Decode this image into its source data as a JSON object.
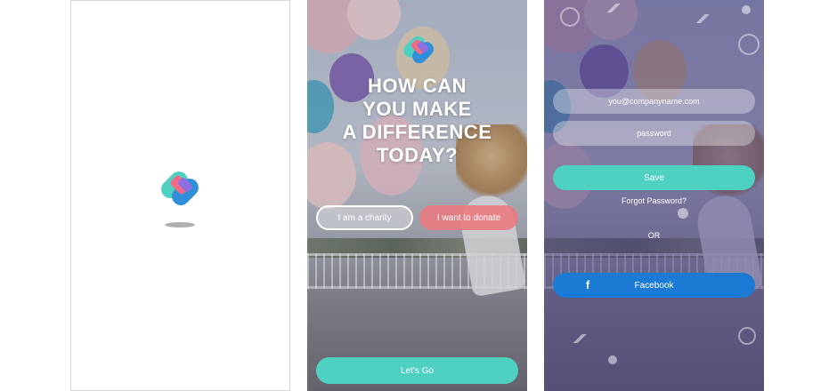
{
  "colors": {
    "teal": "#4fd1c1",
    "coral": "#ec787e",
    "facebook_blue": "#1a7ad4",
    "logo_blue": "#2f8fd9",
    "logo_pink": "#ef6b86",
    "logo_purple": "#8f6fe0"
  },
  "splash": {
    "logo_icon": "app-logo-icon"
  },
  "landing": {
    "headline": [
      "HOW CAN",
      "YOU MAKE",
      "A DIFFERENCE",
      "TODAY?"
    ],
    "charity_label": "I am a charity",
    "donate_label": "I want to donate",
    "letsgo_label": "Let's Go"
  },
  "login": {
    "email_placeholder": "you@companyname.com",
    "password_placeholder": "password",
    "save_label": "Save",
    "forgot_label": "Forgot Password?",
    "or_label": "OR",
    "facebook_label": "Facebook",
    "facebook_icon": "facebook-icon"
  }
}
